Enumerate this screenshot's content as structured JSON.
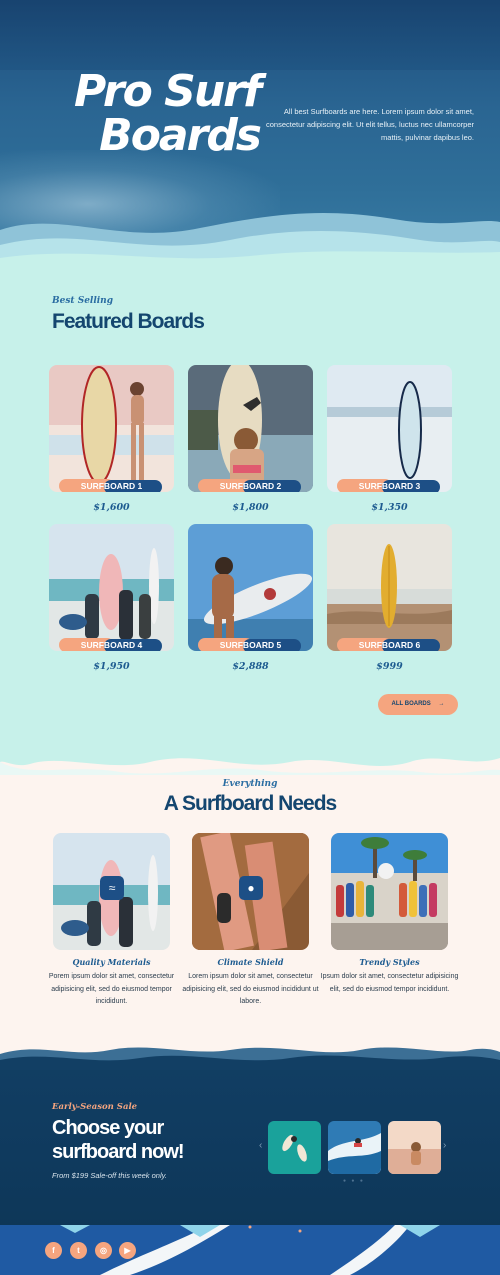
{
  "hero": {
    "title_line1": "Pro Surf",
    "title_line2": "Boards",
    "description": "All best Surfboards are here. Lorem ipsum dolor sit amet, consectetur adipiscing elit. Ut elit tellus, luctus nec ullamcorper mattis, pulvinar dapibus leo."
  },
  "featured": {
    "eyebrow": "Best Selling",
    "heading": "Featured Boards",
    "boards": [
      {
        "name": "SURFBOARD 1",
        "price": "$1,600"
      },
      {
        "name": "SURFBOARD 2",
        "price": "$1,800"
      },
      {
        "name": "SURFBOARD 3",
        "price": "$1,350"
      },
      {
        "name": "SURFBOARD 4",
        "price": "$1,950"
      },
      {
        "name": "SURFBOARD 5",
        "price": "$2,888"
      },
      {
        "name": "SURFBOARD 6",
        "price": "$999"
      }
    ],
    "all_button": "ALL BOARDS",
    "all_button_icon": "arrow-right-icon"
  },
  "needs": {
    "eyebrow": "Everything",
    "heading": "A Surfboard Needs",
    "items": [
      {
        "title": "Quality Materials",
        "text": "Porem ipsum dolor sit amet, consectetur adipisicing elit, sed do eiusmod tempor incididunt.",
        "icon": "wave-badge-icon"
      },
      {
        "title": "Climate Shield",
        "text": "Lorem ipsum dolor sit amet, consectetur adipisicing elit, sed do eiusmod incididunt ut labore.",
        "icon": "drop-badge-icon"
      },
      {
        "title": "Trendy Styles",
        "text": "Ipsum dolor sit amet, consectetur adipisicing elit, sed do eiusmod tempor incididunt.",
        "icon": ""
      }
    ]
  },
  "sale": {
    "eyebrow": "Early-Season Sale",
    "heading_line1": "Choose your",
    "heading_line2": "surfboard now!",
    "subtext": "From $199 Sale-off this week only."
  },
  "footer": {
    "social": [
      "facebook-icon",
      "twitter-icon",
      "instagram-icon",
      "youtube-icon"
    ]
  },
  "colors": {
    "navy": "#14466f",
    "peach": "#f5a57f",
    "mint": "#c7f1ea",
    "cream": "#fdf4ef",
    "blue": "#1d4f86"
  }
}
